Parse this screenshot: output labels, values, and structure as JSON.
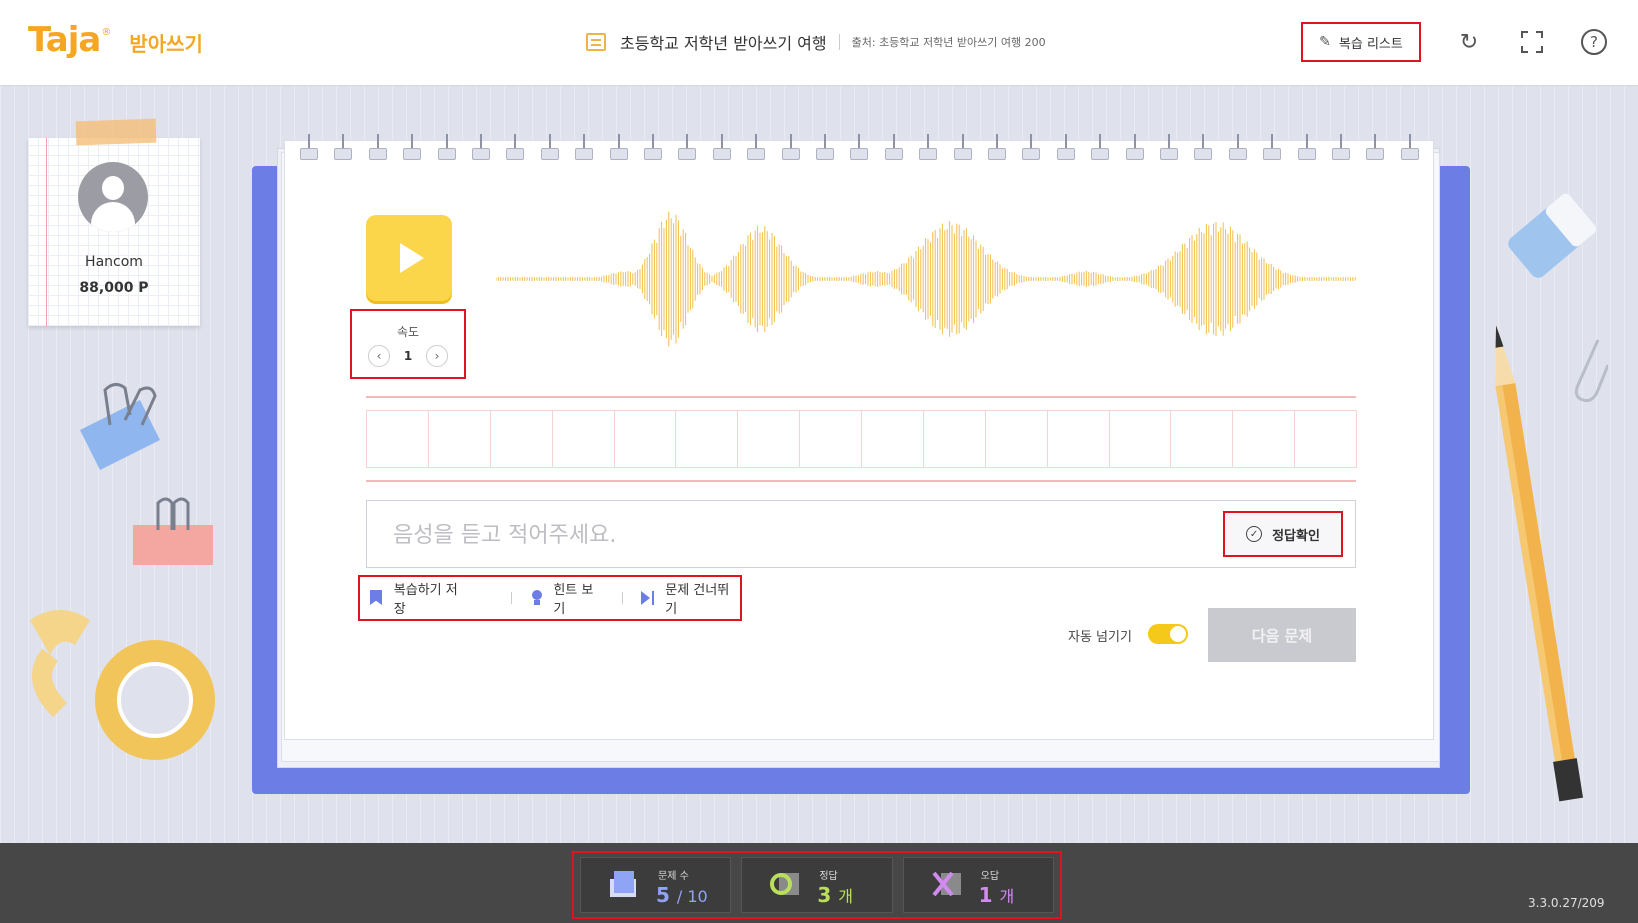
{
  "header": {
    "logo": "Taja",
    "logo_reg": "®",
    "app_name": "받아쓰기",
    "title": "초등학교 저학년 받아쓰기 여행",
    "source": "출처: 초등학교 저학년 받아쓰기 여행 200",
    "review_list_label": "복습 리스트"
  },
  "user": {
    "name": "Hancom",
    "points": "88,000 P"
  },
  "player": {
    "speed_label": "속도",
    "speed_value": "1",
    "speed_prev": "‹",
    "speed_next": "›"
  },
  "answer": {
    "cells": 16,
    "placeholder": "음성을 듣고 적어주세요.",
    "check_label": "정답확인"
  },
  "tools": {
    "save_review": "복습하기 저장",
    "hint": "힌트 보기",
    "skip": "문제 건너뛰기"
  },
  "auto_next": {
    "label": "자동 넘기기",
    "enabled": true
  },
  "next_button": "다음 문제",
  "stats": {
    "questions_label": "문제 수",
    "questions_current": "5",
    "questions_total": "/ 10",
    "correct_label": "정답",
    "correct_value": "3",
    "correct_unit": "개",
    "wrong_label": "오답",
    "wrong_value": "1",
    "wrong_unit": "개"
  },
  "version": "3.3.0.27/209",
  "colors": {
    "accent_orange": "#f5a623",
    "play_yellow": "#fcd64a",
    "notebook_blue": "#6c7ee6",
    "highlight_red": "#e0141e",
    "stat_blue": "#8fa4f5",
    "stat_green": "#b9e05a",
    "stat_purple": "#d08af0"
  },
  "icons": {
    "review": "edit-icon",
    "refresh": "refresh-icon",
    "fullscreen": "fullscreen-icon",
    "help": "help-icon"
  }
}
